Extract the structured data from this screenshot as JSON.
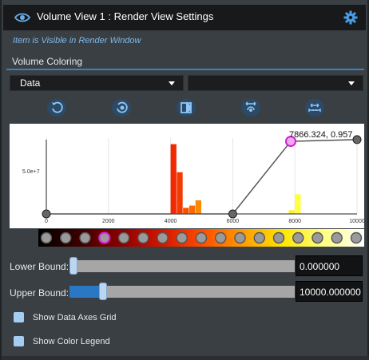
{
  "header": {
    "title": "Volume View 1 : Render View Settings",
    "visibility_icon": "eye-icon",
    "settings_icon": "gear-icon"
  },
  "visible_note": "Item is Visible in Render Window",
  "section": {
    "title": "Volume Coloring"
  },
  "selects": {
    "array": "Data",
    "component": ""
  },
  "toolbar": {
    "icons": [
      "reset-icon",
      "reset-range-icon",
      "invert-icon",
      "fit-data-range-icon",
      "custom-range-icon"
    ]
  },
  "chart": {
    "tooltip": "7866.324, 0.957",
    "ytick": "5.0e+7",
    "xticks": [
      "0",
      "2000",
      "4000",
      "6000",
      "8000",
      "10000"
    ],
    "x_range": [
      0,
      10000
    ]
  },
  "chart_data": {
    "type": "bar",
    "x_range": [
      0,
      10000
    ],
    "histogram": [
      {
        "x": 4000,
        "v": 0.92,
        "color": "#f02a00"
      },
      {
        "x": 4200,
        "v": 0.55,
        "color": "#f33a00"
      },
      {
        "x": 4400,
        "v": 0.08,
        "color": "#f55200"
      },
      {
        "x": 4600,
        "v": 0.11,
        "color": "#f86c00"
      },
      {
        "x": 4800,
        "v": 0.18,
        "color": "#fa8a00"
      },
      {
        "x": 7800,
        "v": 0.05,
        "color": "#fff030"
      },
      {
        "x": 8000,
        "v": 0.26,
        "color": "#ffff40"
      }
    ],
    "opacity_points": [
      {
        "x": 0,
        "y": 0
      },
      {
        "x": 6000,
        "y": 0
      },
      {
        "x": 7866.324,
        "y": 0.957
      },
      {
        "x": 10000,
        "y": 0.98
      }
    ],
    "selected_point": {
      "x": 7866.324,
      "y": 0.957
    }
  },
  "color_map": {
    "stops": [
      "#000000",
      "#3a0000",
      "#8a0000",
      "#d01500",
      "#ff4a00",
      "#ff9a00",
      "#ffe600",
      "#ffff80",
      "#ffffff"
    ],
    "point_count": 17,
    "selected_index": 3
  },
  "bounds": {
    "lower_label": "Lower Bound:",
    "lower_value": "0.000000",
    "lower_fraction": 0.0,
    "upper_label": "Upper Bound:",
    "upper_value": "10000.000000",
    "upper_fraction": 0.15
  },
  "options": [
    {
      "label": "Show Data Axes Grid",
      "checked": false
    },
    {
      "label": "Show Color Legend",
      "checked": false
    }
  ]
}
